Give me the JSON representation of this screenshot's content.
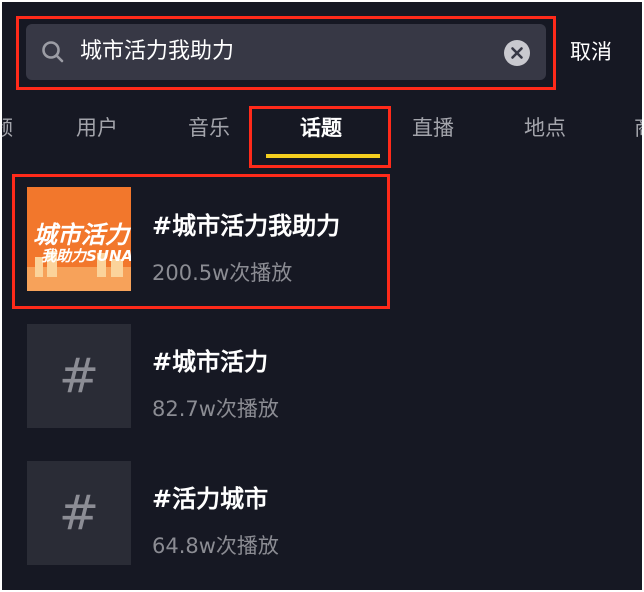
{
  "search": {
    "query": "城市活力我助力",
    "cancel_label": "取消"
  },
  "tabs": [
    {
      "label": "频",
      "active": false
    },
    {
      "label": "用户",
      "active": false
    },
    {
      "label": "音乐",
      "active": false
    },
    {
      "label": "话题",
      "active": true
    },
    {
      "label": "直播",
      "active": false
    },
    {
      "label": "地点",
      "active": false
    },
    {
      "label": "商",
      "active": false
    }
  ],
  "results": [
    {
      "title": "#城市活力我助力",
      "plays": "200.5w次播放",
      "cover_lines": [
        "城市活力",
        "我助力SUNAC"
      ],
      "icon": "topic-cover-image"
    },
    {
      "title": "#城市活力",
      "plays": "82.7w次播放",
      "icon_glyph": "#",
      "icon": "hashtag-icon"
    },
    {
      "title": "#活力城市",
      "plays": "64.8w次播放",
      "icon_glyph": "#",
      "icon": "hashtag-icon"
    }
  ],
  "colors": {
    "background": "#161823",
    "highlight": "#ff2a1a",
    "tab_underline": "#f4cf1f",
    "cover_orange": "#f2772c"
  }
}
